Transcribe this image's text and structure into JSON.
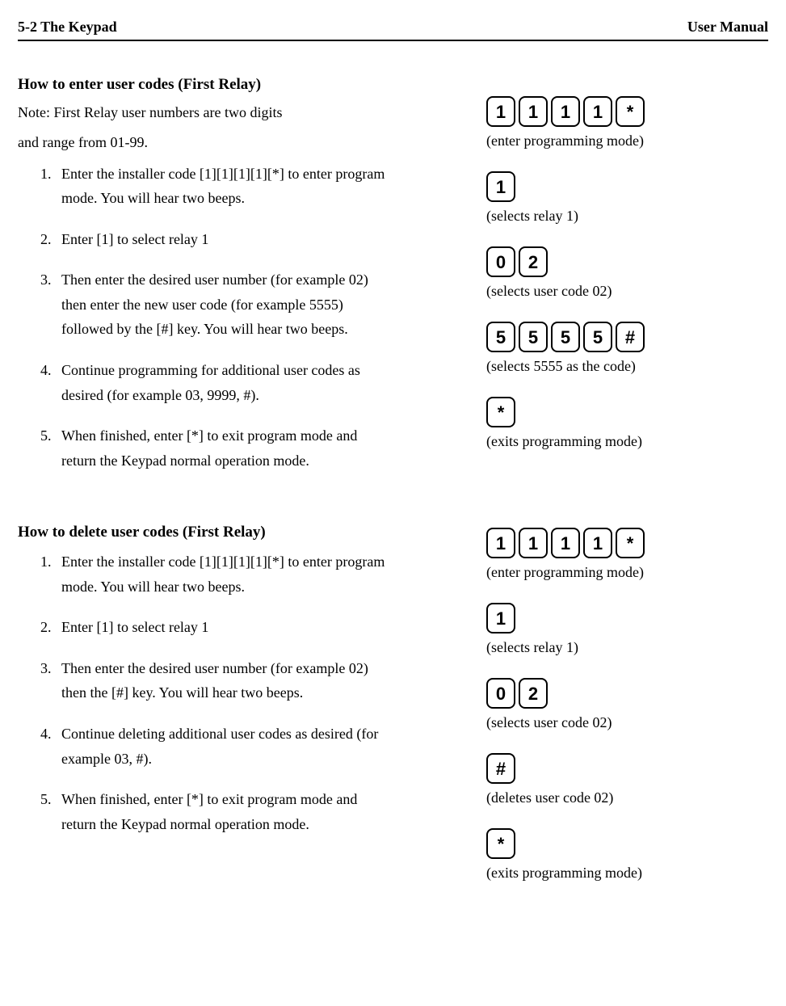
{
  "header": {
    "left": "5-2 The Keypad",
    "right": "User Manual"
  },
  "section1": {
    "title": "How to enter user codes (First Relay)",
    "note_l1": "Note: First Relay user numbers are two digits",
    "note_l2": "and range from 01-99.",
    "steps": [
      "Enter the installer code [1][1][1][1][*] to enter program mode. You will hear two beeps.",
      "Enter [1] to select relay 1",
      "Then enter the desired user number (for example 02) then enter the new user code (for example 5555) followed by the [#] key. You will hear two beeps.",
      "Continue programming for additional user codes as desired (for example 03, 9999, #).",
      "When finished, enter [*] to exit program mode and return the Keypad normal operation mode."
    ],
    "keys": {
      "row1": [
        "1",
        "1",
        "1",
        "1",
        "*"
      ],
      "cap1": "(enter programming mode)",
      "row2": [
        "1"
      ],
      "cap2": "(selects relay 1)",
      "row3": [
        "0",
        "2"
      ],
      "cap3": "(selects user code 02)",
      "row4": [
        "5",
        "5",
        "5",
        "5",
        "#"
      ],
      "cap4": "(selects 5555 as the code)",
      "row5": [
        "*"
      ],
      "cap5": "(exits programming mode)"
    }
  },
  "section2": {
    "title": "How to delete user codes (First Relay)",
    "steps": [
      "Enter the installer code [1][1][1][1][*] to enter program mode. You will hear two beeps.",
      "Enter [1] to select relay 1",
      "Then enter the desired user number (for example 02) then the [#] key. You will hear two beeps.",
      "Continue deleting additional user codes as desired (for example 03, #).",
      "When finished, enter [*] to exit program mode and return the Keypad normal operation mode."
    ],
    "keys": {
      "row1": [
        "1",
        "1",
        "1",
        "1",
        "*"
      ],
      "cap1": "(enter programming mode)",
      "row2": [
        "1"
      ],
      "cap2": "(selects relay 1)",
      "row3": [
        "0",
        "2"
      ],
      "cap3": "(selects user code 02)",
      "row4": [
        "#"
      ],
      "cap4": "(deletes user code 02)",
      "row5": [
        "*"
      ],
      "cap5": "(exits programming mode)"
    }
  }
}
